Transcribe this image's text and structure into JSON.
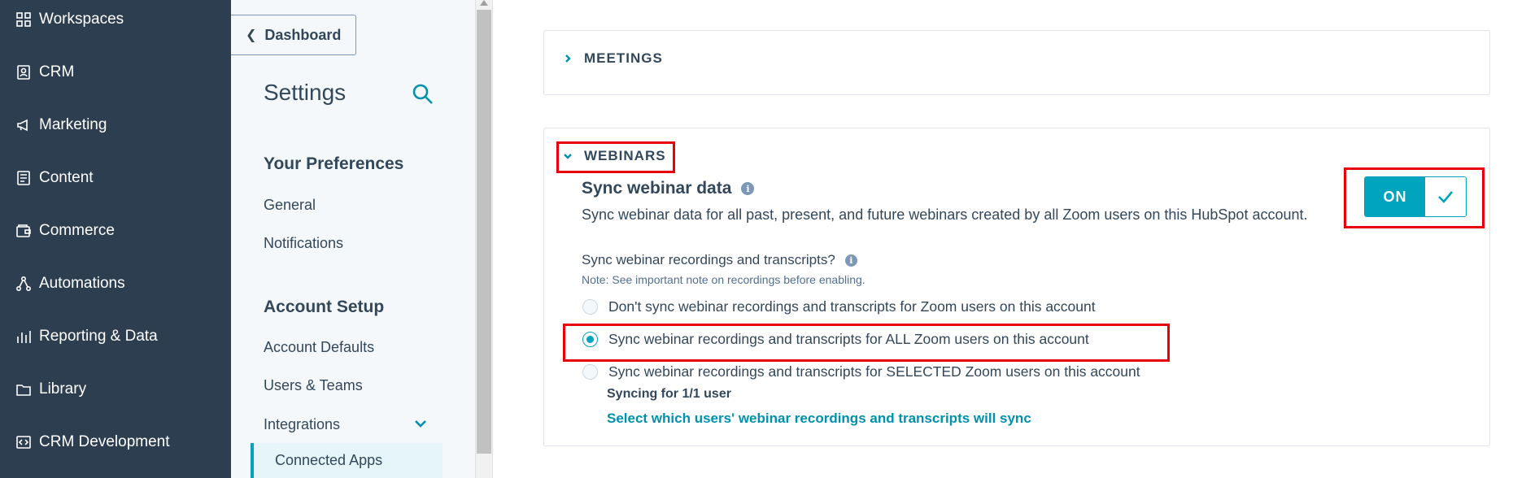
{
  "nav": {
    "items": [
      {
        "label": "Workspaces",
        "icon": "grid-icon"
      },
      {
        "label": "CRM",
        "icon": "contacts-icon"
      },
      {
        "label": "Marketing",
        "icon": "megaphone-icon"
      },
      {
        "label": "Content",
        "icon": "content-icon"
      },
      {
        "label": "Commerce",
        "icon": "wallet-icon"
      },
      {
        "label": "Automations",
        "icon": "automation-icon"
      },
      {
        "label": "Reporting & Data",
        "icon": "bar-chart-icon"
      },
      {
        "label": "Library",
        "icon": "folder-icon"
      },
      {
        "label": "CRM Development",
        "icon": "code-icon"
      }
    ]
  },
  "sidebar": {
    "back_label": "Dashboard",
    "title": "Settings",
    "sections": [
      {
        "heading": "Your Preferences",
        "items": [
          "General",
          "Notifications"
        ]
      },
      {
        "heading": "Account Setup",
        "items": [
          "Account Defaults",
          "Users & Teams",
          "Integrations",
          "Connected Apps"
        ]
      }
    ]
  },
  "main": {
    "meetings": {
      "label": "MEETINGS",
      "expanded": false
    },
    "webinars": {
      "label": "WEBINARS",
      "expanded": true,
      "sync_title": "Sync webinar data",
      "sync_desc": "Sync webinar data for all past, present, and future webinars created by all Zoom users on this HubSpot account.",
      "toggle": {
        "label": "ON",
        "state": true
      },
      "question": "Sync webinar recordings and transcripts?",
      "note": "Note: See important note on recordings before enabling.",
      "options": [
        {
          "label": "Don't sync webinar recordings and transcripts for Zoom users on this account",
          "selected": false
        },
        {
          "label": "Sync webinar recordings and transcripts for ALL Zoom users on this account",
          "selected": true
        },
        {
          "label": "Sync webinar recordings and transcripts for SELECTED Zoom users on this account",
          "selected": false
        }
      ],
      "syncing_status": "Syncing for 1/1 user",
      "select_users_link": "Select which users' webinar recordings and transcripts will sync"
    }
  },
  "colors": {
    "accent": "#00a4bd",
    "link": "#0091ae",
    "nav_bg": "#2d3e50",
    "highlight": "#e8000b"
  }
}
